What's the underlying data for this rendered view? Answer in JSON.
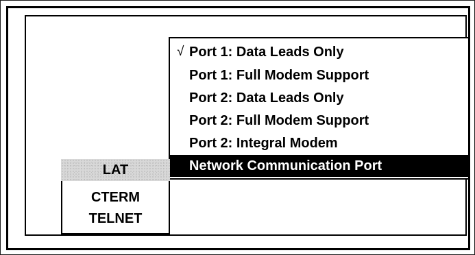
{
  "menu": {
    "items": [
      {
        "label": "Port 1: Data Leads Only",
        "check": "√",
        "checked": true,
        "selected": false
      },
      {
        "label": "Port 1: Full Modem Support",
        "check": "",
        "checked": false,
        "selected": false
      },
      {
        "label": "Port 2: Data Leads Only",
        "check": "",
        "checked": false,
        "selected": false
      },
      {
        "label": "Port 2: Full Modem Support",
        "check": "",
        "checked": false,
        "selected": false
      },
      {
        "label": "Port 2: Integral Modem",
        "check": "",
        "checked": false,
        "selected": false
      },
      {
        "label": "Network Communication Port",
        "check": "",
        "checked": false,
        "selected": true
      }
    ]
  },
  "submenu": {
    "items": [
      {
        "label": "LAT",
        "highlighted": true
      },
      {
        "label": "CTERM",
        "highlighted": false
      },
      {
        "label": "TELNET",
        "highlighted": false
      }
    ]
  },
  "colors": {
    "selected_bg": "#000000",
    "selected_text": "#ffffff",
    "highlight_bg": "#d8d8d8"
  }
}
